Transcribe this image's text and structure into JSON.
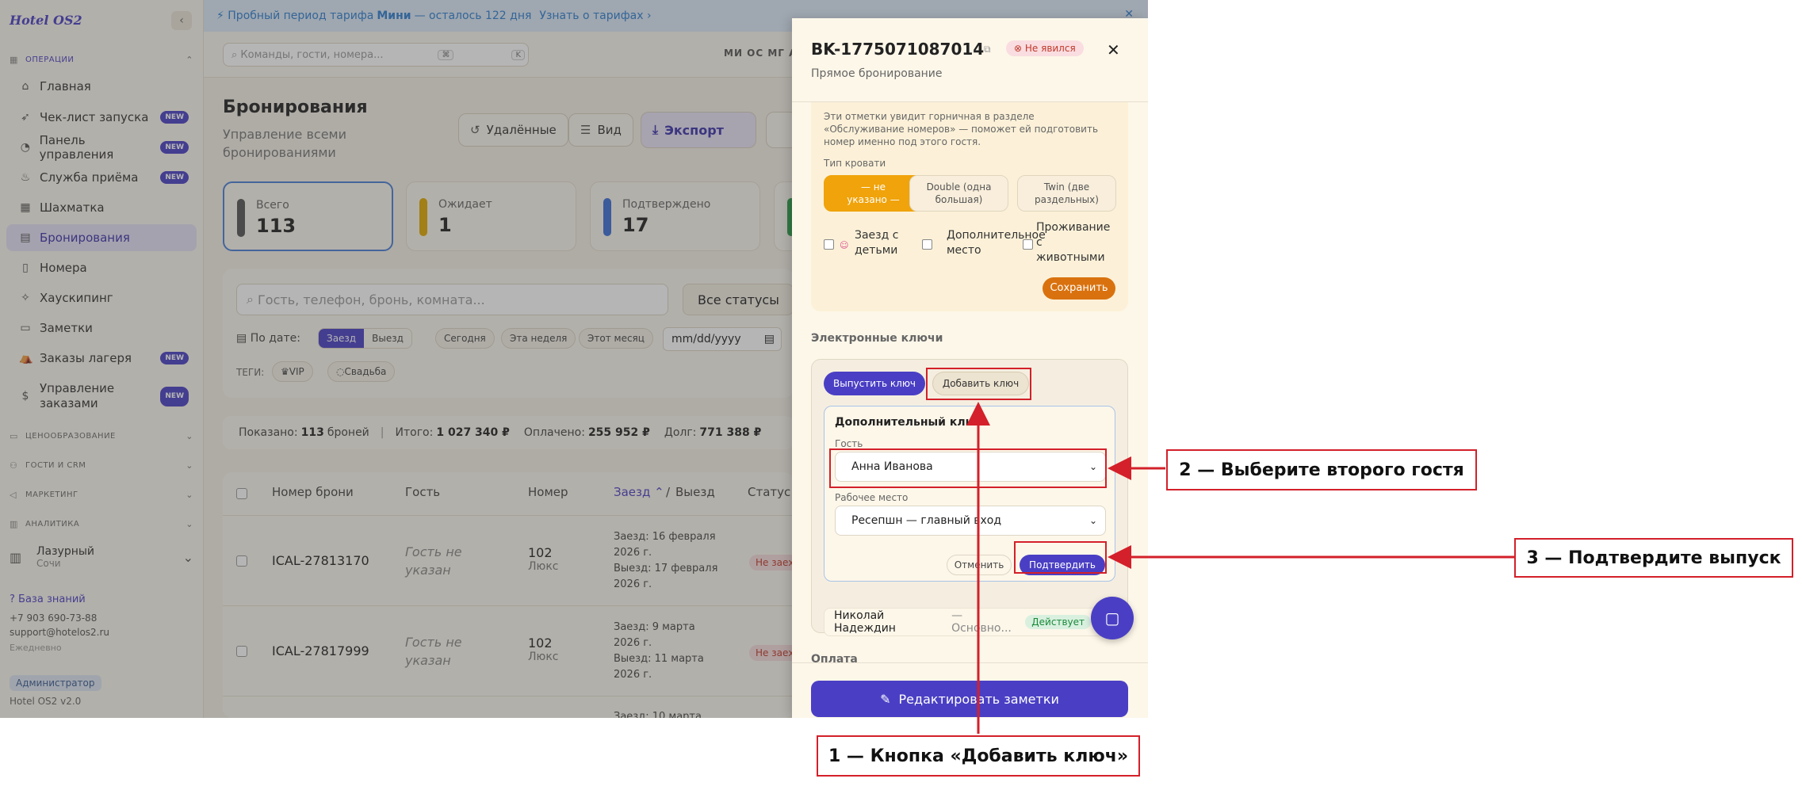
{
  "sidebar": {
    "logo": "Hotel OS2",
    "sections": {
      "operations": "ОПЕРАЦИИ",
      "pricing": "ЦЕНООБРАЗОВАНИЕ",
      "guests": "ГОСТИ И CRM",
      "marketing": "МАРКЕТИНГ",
      "analytics": "АНАЛИТИКА"
    },
    "items": [
      {
        "label": "Главная",
        "icon": "home-icon"
      },
      {
        "label": "Чек-лист запуска",
        "icon": "rocket-icon",
        "badge": "NEW"
      },
      {
        "label": "Панель управления",
        "icon": "gauge-icon",
        "badge": "NEW"
      },
      {
        "label": "Служба приёма",
        "icon": "bell-icon",
        "badge": "NEW"
      },
      {
        "label": "Шахматка",
        "icon": "grid-icon"
      },
      {
        "label": "Бронирования",
        "icon": "calendar-icon"
      },
      {
        "label": "Номера",
        "icon": "door-icon"
      },
      {
        "label": "Хаускипинг",
        "icon": "broom-icon"
      },
      {
        "label": "Заметки",
        "icon": "note-icon"
      },
      {
        "label": "Заказы лагеря",
        "icon": "tent-icon",
        "badge": "NEW"
      },
      {
        "label": "Управление",
        "label2": "заказами",
        "icon": "receipt-icon",
        "badge": "NEW"
      }
    ],
    "hotel": {
      "name": "Лазурный",
      "city": "Сочи"
    },
    "knowledge_base": "База знаний",
    "phone": "+7 903 690-73-88",
    "email": "support@hotelos2.ru",
    "schedule": "Ежедневно",
    "role": "Администратор",
    "version": "Hotel OS2 v2.0"
  },
  "banner": {
    "pre": "Пробный период тарифа",
    "plan": "Мини",
    "post": "— осталось 122 дня",
    "link": "Узнать о тарифах ›"
  },
  "topbar": {
    "search_placeholder": "Команды, гости, номера...",
    "kbd1": "⌘",
    "kbd2": "K",
    "avatars": "МИ ОС МГ АК"
  },
  "page": {
    "title": "Бронирования",
    "subtitle": "Управление всеми бронированиями",
    "btn_deleted": "Удалённые",
    "btn_view": "Вид",
    "btn_export": "Экспорт"
  },
  "kpis": [
    {
      "label": "Всего",
      "value": "113",
      "color": "#555555"
    },
    {
      "label": "Ожидает",
      "value": "1",
      "color": "#e0a800"
    },
    {
      "label": "Подтверждено",
      "value": "17",
      "color": "#3b6fd6"
    }
  ],
  "filters": {
    "search_placeholder": "Гость, телефон, бронь, комната...",
    "status": "Все статусы",
    "by_date": "По дате:",
    "seg_checkin": "Заезд",
    "seg_checkout": "Выезд",
    "today": "Сегодня",
    "this_week": "Эта неделя",
    "this_month": "Этот месяц",
    "date_placeholder": "mm/dd/yyyy",
    "tags_label": "ТЕГИ:",
    "tag_vip": "VIP",
    "tag_wedding": "Свадьба"
  },
  "summary": {
    "shown_label": "Показано:",
    "shown_count": "113",
    "shown_unit": "броней",
    "total_label": "Итого:",
    "total": "1 027 340 ₽",
    "paid_label": "Оплачено:",
    "paid": "255 952 ₽",
    "debt_label": "Долг:",
    "debt": "771 388 ₽"
  },
  "table": {
    "headers": {
      "booking": "Номер брони",
      "guest": "Гость",
      "room": "Номер",
      "checkin": "Заезд",
      "slash": "/",
      "checkout": "Выезд",
      "status": "Статус"
    },
    "rows": [
      {
        "id": "ICAL-27813170",
        "guest1": "Гость не",
        "guest2": "указан",
        "room": "102",
        "room_type": "Люкс",
        "in1": "Заезд: 16 февраля",
        "in2": "2026 г.",
        "out1": "Выезд: 17 февраля",
        "out2": "2026 г.",
        "status": "Не заех"
      },
      {
        "id": "ICAL-27817999",
        "guest1": "Гость не",
        "guest2": "указан",
        "room": "102",
        "room_type": "Люкс",
        "in1": "Заезд: 9 марта",
        "in2": "2026 г.",
        "out1": "Выезд: 11 марта",
        "out2": "2026 г.",
        "status": "Не заех"
      },
      {
        "in1": "Заезд: 10 марта"
      }
    ]
  },
  "panel": {
    "booking_id": "BK-1775071087014",
    "status": "Не явился",
    "source": "Прямое бронирование",
    "note_text": "Эти отметки увидит горничная в разделе «Обслуживание номеров» — поможет ей подготовить номер именно под этого гостя.",
    "bed_type_label": "Тип кровати",
    "bed_options": [
      {
        "l1": "— не",
        "l2": "указано —"
      },
      {
        "l1": "Double (одна",
        "l2": "большая)"
      },
      {
        "l1": "Twin (две",
        "l2": "раздельных)"
      }
    ],
    "check_children_1": "Заезд с",
    "check_children_2": "детьми",
    "check_extra_1": "Дополнительное",
    "check_extra_2": "место",
    "check_pets_1": "Проживание",
    "check_pets_2": "с",
    "check_pets_3": "животными",
    "save": "Сохранить",
    "ekeys_title": "Электронные ключи",
    "issue_key": "Выпустить ключ",
    "add_key": "Добавить ключ",
    "extra_key_title": "Дополнительный ключ",
    "guest_label": "Гость",
    "guest_value": "Анна Иванова",
    "workplace_label": "Рабочее место",
    "workplace_value": "Ресепшн — главный вход",
    "cancel": "Отменить",
    "confirm": "Подтвердить",
    "existing_key_name": "Николай Надеждин",
    "existing_key_type": "— Основно...",
    "existing_key_status": "Действует",
    "payment_title": "Оплата",
    "edit_notes": "Редактировать заметки"
  },
  "annotations": {
    "step1": "1 — Кнопка «Добавить ключ»",
    "step2": "2 — Выберите второго гостя",
    "step3": "3 — Подтвердите выпуск",
    "color": "#d3202a"
  }
}
